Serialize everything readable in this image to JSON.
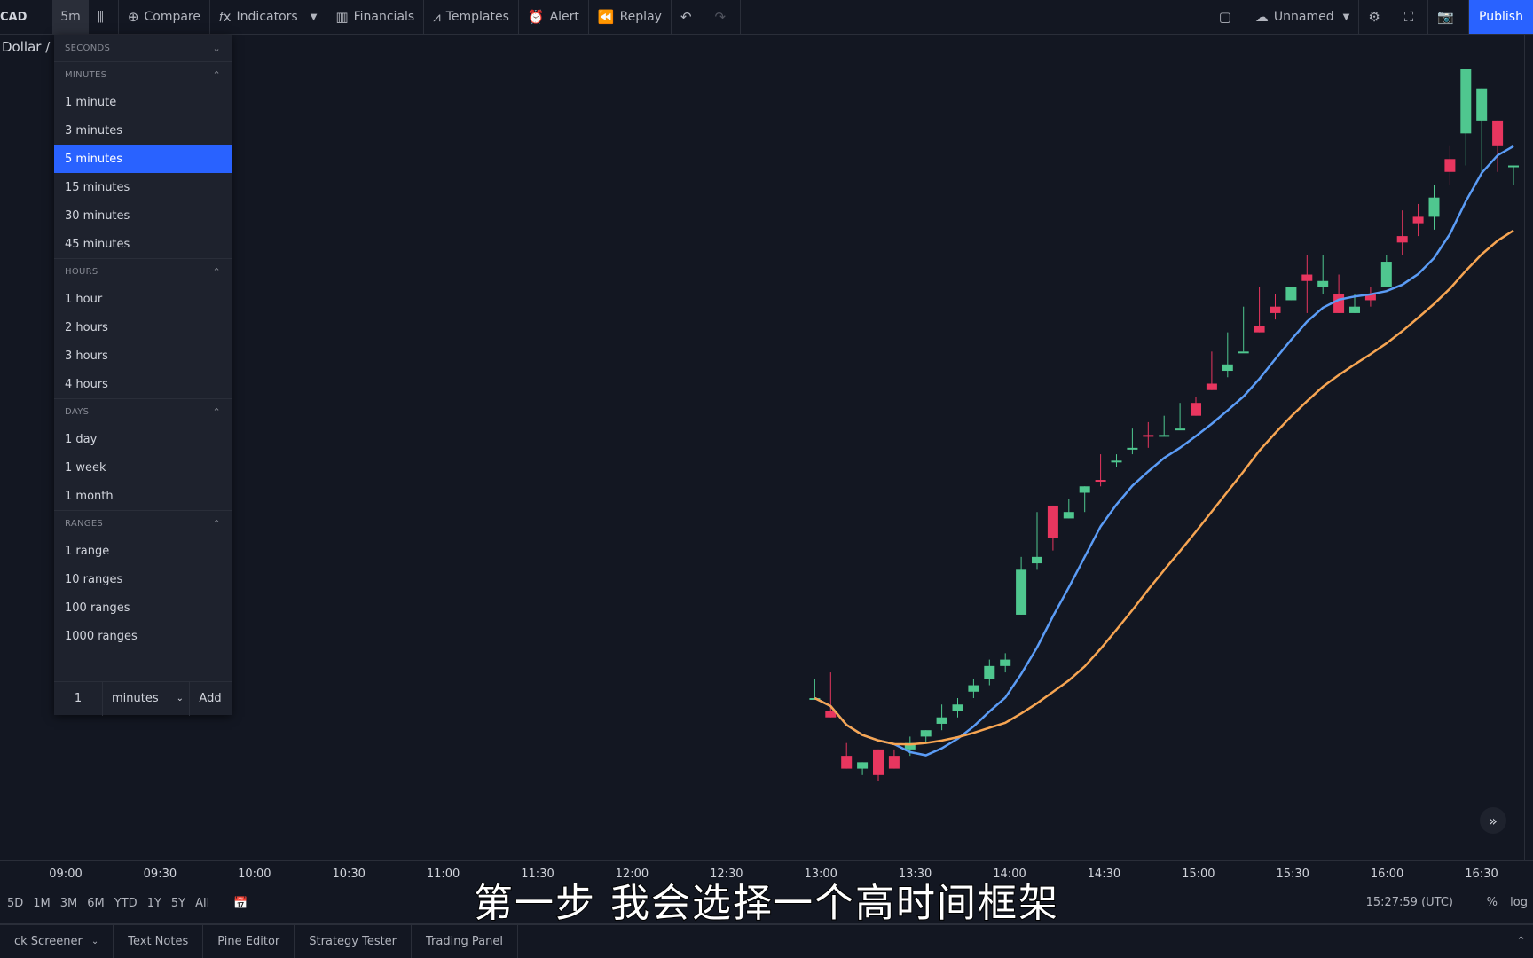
{
  "topbar": {
    "symbol": "CAD",
    "resolution": "5m",
    "compare": "Compare",
    "indicators": "Indicators",
    "financials": "Financials",
    "templates": "Templates",
    "alert": "Alert",
    "replay": "Replay",
    "layout_name": "Unnamed",
    "publish": "Publish"
  },
  "legend": {
    "title": "Dollar /"
  },
  "dropdown": {
    "seconds_header": "SECONDS",
    "minutes_header": "MINUTES",
    "minutes": [
      "1 minute",
      "3 minutes",
      "5 minutes",
      "15 minutes",
      "30 minutes",
      "45 minutes"
    ],
    "selected": "5 minutes",
    "hours_header": "HOURS",
    "hours": [
      "1 hour",
      "2 hours",
      "3 hours",
      "4 hours"
    ],
    "days_header": "DAYS",
    "days": [
      "1 day",
      "1 week",
      "1 month"
    ],
    "ranges_header": "RANGES",
    "ranges": [
      "1 range",
      "10 ranges",
      "100 ranges",
      "1000 ranges"
    ],
    "custom": {
      "value": "1",
      "unit": "minutes",
      "add": "Add"
    }
  },
  "xaxis": {
    "ticks": [
      "09:00",
      "09:30",
      "10:00",
      "10:30",
      "11:00",
      "11:30",
      "12:00",
      "12:30",
      "13:00",
      "13:30",
      "14:00",
      "14:30",
      "15:00",
      "15:30",
      "16:00",
      "16:30"
    ]
  },
  "rangebar": {
    "ranges": [
      "5D",
      "1M",
      "3M",
      "6M",
      "YTD",
      "1Y",
      "5Y",
      "All"
    ],
    "time": "15:27:59 (UTC)",
    "percent": "%",
    "log": "log"
  },
  "bottombar": {
    "tabs": [
      "ck Screener",
      "Text Notes",
      "Pine Editor",
      "Strategy Tester",
      "Trading Panel"
    ]
  },
  "subtitle": "第一步  我会选择一个高时间框架",
  "colors": {
    "up": "#4fc78f",
    "down": "#e8365f",
    "ma_fast": "#5b9cf6",
    "ma_slow": "#f7a552",
    "accent": "#2962ff"
  },
  "chart_data": {
    "type": "candlestick",
    "x_ticks": [
      "09:00",
      "09:30",
      "10:00",
      "10:30",
      "11:00",
      "11:30",
      "12:00",
      "12:30",
      "13:00",
      "13:30",
      "14:00",
      "14:30",
      "15:00",
      "15:30",
      "16:00",
      "16:30"
    ],
    "candles": [
      [
        100,
        100,
        97,
        97,
        1
      ],
      [
        103,
        107,
        99,
        106,
        0
      ],
      [
        112,
        107,
        99,
        110,
        1
      ],
      [
        115,
        105,
        100,
        105,
        1
      ],
      [
        99,
        101,
        97,
        103,
        0
      ],
      [
        95,
        92,
        90,
        97,
        1
      ],
      [
        92,
        91,
        89,
        94,
        0
      ],
      [
        88,
        89,
        86,
        93,
        0
      ],
      [
        85,
        81,
        81,
        86,
        1
      ],
      [
        79,
        80,
        78,
        81,
        0
      ],
      [
        77,
        78,
        77,
        80,
        1
      ],
      [
        77,
        80,
        78,
        83,
        0
      ],
      [
        81,
        82,
        80,
        86,
        1
      ],
      [
        82,
        83,
        77,
        86,
        0
      ],
      [
        81,
        79,
        79,
        81,
        1
      ],
      [
        77,
        78,
        76,
        80,
        0
      ],
      [
        74,
        75,
        75,
        81,
        0
      ],
      [
        71,
        71,
        71,
        78,
        1
      ],
      [
        68,
        69,
        67,
        74,
        1
      ],
      [
        65,
        66,
        65,
        71,
        0
      ],
      [
        61,
        63,
        61,
        64,
        0
      ],
      [
        59,
        59,
        60,
        63,
        1
      ],
      [
        58,
        58,
        59,
        61,
        1
      ],
      [
        58,
        58,
        56,
        60,
        0
      ],
      [
        56,
        56,
        55,
        59,
        1
      ],
      [
        54,
        54,
        53,
        55,
        1
      ],
      [
        51,
        51,
        50,
        55,
        0
      ],
      [
        49,
        50,
        46,
        49,
        1
      ],
      [
        45,
        46,
        45,
        48,
        1
      ],
      [
        42,
        47,
        40,
        44,
        0
      ],
      [
        38,
        39,
        37,
        46,
        1
      ],
      [
        30,
        37,
        30,
        39,
        1
      ],
      [
        22,
        23,
        21,
        24,
        1
      ],
      [
        20,
        22,
        19,
        23,
        1
      ],
      [
        18,
        19,
        17,
        20,
        1
      ],
      [
        15,
        16,
        14,
        17,
        1
      ],
      [
        13,
        14,
        12,
        16,
        1
      ],
      [
        11,
        12,
        10,
        12,
        1
      ],
      [
        9,
        10,
        8,
        11,
        1
      ],
      [
        8,
        6,
        6,
        9,
        0
      ],
      [
        9,
        5,
        4,
        8,
        0
      ],
      [
        7,
        6,
        5,
        6,
        1
      ],
      [
        8,
        6,
        6,
        10,
        0
      ],
      [
        15,
        14,
        14,
        21,
        0
      ],
      [
        17,
        17,
        17,
        20,
        1
      ]
    ],
    "ma_fast_name": "",
    "ma_slow_name": ""
  }
}
